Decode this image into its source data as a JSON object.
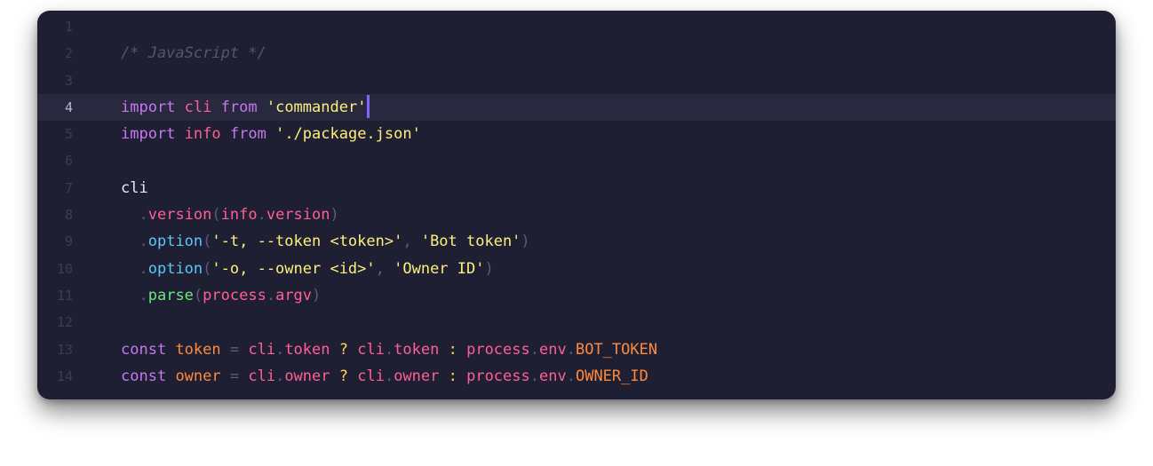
{
  "editor": {
    "language_comment": "/* JavaScript */",
    "active_line": 4,
    "lines": [
      {
        "number": "1",
        "tokens": []
      },
      {
        "number": "2",
        "tokens": [
          {
            "t": "/* JavaScript */",
            "c": "com"
          }
        ]
      },
      {
        "number": "3",
        "tokens": []
      },
      {
        "number": "4",
        "tokens": [
          {
            "t": "import",
            "c": "kw"
          },
          {
            "t": " ",
            "c": "plain"
          },
          {
            "t": "cli",
            "c": "id"
          },
          {
            "t": " ",
            "c": "plain"
          },
          {
            "t": "from",
            "c": "kw"
          },
          {
            "t": " ",
            "c": "plain"
          },
          {
            "t": "'commander'",
            "c": "str"
          }
        ],
        "cursor": true
      },
      {
        "number": "5",
        "tokens": [
          {
            "t": "import",
            "c": "kw"
          },
          {
            "t": " ",
            "c": "plain"
          },
          {
            "t": "info",
            "c": "id"
          },
          {
            "t": " ",
            "c": "plain"
          },
          {
            "t": "from",
            "c": "kw"
          },
          {
            "t": " ",
            "c": "plain"
          },
          {
            "t": "'./package.json'",
            "c": "str"
          }
        ]
      },
      {
        "number": "6",
        "tokens": []
      },
      {
        "number": "7",
        "tokens": [
          {
            "t": "cli",
            "c": "plain"
          }
        ]
      },
      {
        "number": "8",
        "tokens": [
          {
            "t": "  ",
            "c": "plain"
          },
          {
            "t": ".",
            "c": "dot"
          },
          {
            "t": "version",
            "c": "method"
          },
          {
            "t": "(",
            "c": "punc"
          },
          {
            "t": "info",
            "c": "id"
          },
          {
            "t": ".",
            "c": "dot"
          },
          {
            "t": "version",
            "c": "method"
          },
          {
            "t": ")",
            "c": "punc"
          }
        ]
      },
      {
        "number": "9",
        "tokens": [
          {
            "t": "  ",
            "c": "plain"
          },
          {
            "t": ".",
            "c": "dot"
          },
          {
            "t": "option",
            "c": "method-blue"
          },
          {
            "t": "(",
            "c": "punc"
          },
          {
            "t": "'-t, --token <token>'",
            "c": "str"
          },
          {
            "t": ", ",
            "c": "punc"
          },
          {
            "t": "'Bot token'",
            "c": "str"
          },
          {
            "t": ")",
            "c": "punc"
          }
        ]
      },
      {
        "number": "10",
        "tokens": [
          {
            "t": "  ",
            "c": "plain"
          },
          {
            "t": ".",
            "c": "dot"
          },
          {
            "t": "option",
            "c": "method-blue"
          },
          {
            "t": "(",
            "c": "punc"
          },
          {
            "t": "'-o, --owner <id>'",
            "c": "str"
          },
          {
            "t": ", ",
            "c": "punc"
          },
          {
            "t": "'Owner ID'",
            "c": "str"
          },
          {
            "t": ")",
            "c": "punc"
          }
        ]
      },
      {
        "number": "11",
        "tokens": [
          {
            "t": "  ",
            "c": "plain"
          },
          {
            "t": ".",
            "c": "dot"
          },
          {
            "t": "parse",
            "c": "method-green"
          },
          {
            "t": "(",
            "c": "punc"
          },
          {
            "t": "process",
            "c": "id"
          },
          {
            "t": ".",
            "c": "dot"
          },
          {
            "t": "argv",
            "c": "id"
          },
          {
            "t": ")",
            "c": "punc"
          }
        ]
      },
      {
        "number": "12",
        "tokens": []
      },
      {
        "number": "13",
        "tokens": [
          {
            "t": "const",
            "c": "kw"
          },
          {
            "t": " ",
            "c": "plain"
          },
          {
            "t": "token",
            "c": "const"
          },
          {
            "t": " = ",
            "c": "punc"
          },
          {
            "t": "cli",
            "c": "id"
          },
          {
            "t": ".",
            "c": "dot"
          },
          {
            "t": "token",
            "c": "id"
          },
          {
            "t": " ? ",
            "c": "op"
          },
          {
            "t": "cli",
            "c": "id"
          },
          {
            "t": ".",
            "c": "dot"
          },
          {
            "t": "token",
            "c": "id"
          },
          {
            "t": " : ",
            "c": "op"
          },
          {
            "t": "process",
            "c": "id"
          },
          {
            "t": ".",
            "c": "dot"
          },
          {
            "t": "env",
            "c": "id"
          },
          {
            "t": ".",
            "c": "dot"
          },
          {
            "t": "BOT_TOKEN",
            "c": "const"
          }
        ]
      },
      {
        "number": "14",
        "tokens": [
          {
            "t": "const",
            "c": "kw"
          },
          {
            "t": " ",
            "c": "plain"
          },
          {
            "t": "owner",
            "c": "const"
          },
          {
            "t": " = ",
            "c": "punc"
          },
          {
            "t": "cli",
            "c": "id"
          },
          {
            "t": ".",
            "c": "dot"
          },
          {
            "t": "owner",
            "c": "id"
          },
          {
            "t": " ? ",
            "c": "op"
          },
          {
            "t": "cli",
            "c": "id"
          },
          {
            "t": ".",
            "c": "dot"
          },
          {
            "t": "owner",
            "c": "id"
          },
          {
            "t": " : ",
            "c": "op"
          },
          {
            "t": "process",
            "c": "id"
          },
          {
            "t": ".",
            "c": "dot"
          },
          {
            "t": "env",
            "c": "id"
          },
          {
            "t": ".",
            "c": "dot"
          },
          {
            "t": "OWNER_ID",
            "c": "const"
          }
        ]
      }
    ]
  }
}
